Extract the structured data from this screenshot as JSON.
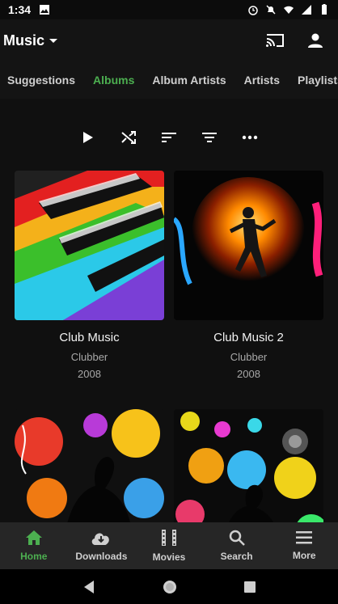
{
  "status": {
    "time": "1:34"
  },
  "appbar": {
    "title": "Music"
  },
  "tabs": [
    {
      "label": "Suggestions"
    },
    {
      "label": "Albums"
    },
    {
      "label": "Album Artists"
    },
    {
      "label": "Artists"
    },
    {
      "label": "Playlists"
    }
  ],
  "albums": [
    {
      "name": "Club Music",
      "artist": "Clubber",
      "year": "2008"
    },
    {
      "name": "Club Music 2",
      "artist": "Clubber",
      "year": "2008"
    },
    {
      "name": "",
      "artist": "",
      "year": ""
    },
    {
      "name": "",
      "artist": "",
      "year": ""
    }
  ],
  "bottomnav": [
    {
      "label": "Home"
    },
    {
      "label": "Downloads"
    },
    {
      "label": "Movies"
    },
    {
      "label": "Search"
    },
    {
      "label": "More"
    }
  ],
  "colors": {
    "accent": "#4caf50",
    "background": "#101010"
  }
}
